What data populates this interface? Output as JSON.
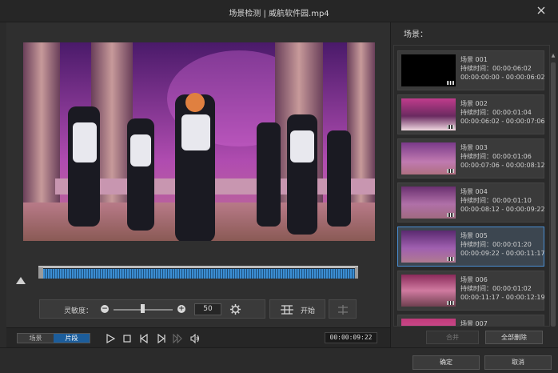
{
  "window": {
    "title": "场景检测 | 威航软件园.mp4"
  },
  "sensitivity": {
    "label": "灵敏度：",
    "value": "50",
    "level_fraction": 0.5
  },
  "actions": {
    "start_label": "开始"
  },
  "controls": {
    "tabs": [
      {
        "label": "场景",
        "active": false
      },
      {
        "label": "片段",
        "active": true
      }
    ],
    "timecode": "00:00:09:22"
  },
  "scenes_panel": {
    "header": "场景：",
    "items": [
      {
        "name": "场景 001",
        "duration": "持续时间：00:00:06:02",
        "range": "00:00:00:00 - 00:00:06:02",
        "selected": false
      },
      {
        "name": "场景 002",
        "duration": "持续时间：00:00:01:04",
        "range": "00:00:06:02 - 00:00:07:06",
        "selected": false
      },
      {
        "name": "场景 003",
        "duration": "持续时间：00:00:01:06",
        "range": "00:00:07:06 - 00:00:08:12",
        "selected": false
      },
      {
        "name": "场景 004",
        "duration": "持续时间：00:00:01:10",
        "range": "00:00:08:12 - 00:00:09:22",
        "selected": false
      },
      {
        "name": "场景 005",
        "duration": "持续时间：00:00:01:20",
        "range": "00:00:09:22 - 00:00:11:17",
        "selected": true
      },
      {
        "name": "场景 006",
        "duration": "持续时间：00:00:01:02",
        "range": "00:00:11:17 - 00:00:12:19",
        "selected": false
      },
      {
        "name": "场景 007",
        "duration": "",
        "range": "",
        "selected": false
      }
    ],
    "merge_label": "合并",
    "delete_all_label": "全部删除"
  },
  "footer": {
    "ok_label": "确定",
    "cancel_label": "取消"
  },
  "colors": {
    "accent": "#1c5d9b",
    "timeline": "#3b8ed3",
    "selection_border": "#4a8fd4"
  }
}
